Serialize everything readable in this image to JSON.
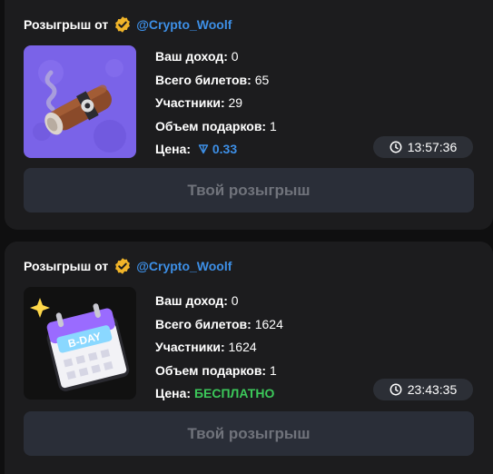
{
  "giveaways": [
    {
      "from_label": "Розыгрыш от",
      "username": "@Crypto_Woolf",
      "income_label": "Ваш доход:",
      "income_value": "0",
      "tickets_label": "Всего билетов:",
      "tickets_value": "65",
      "participants_label": "Участники:",
      "participants_value": "29",
      "gifts_label": "Объем подарков:",
      "gifts_value": "1",
      "price_label": "Цена:",
      "price_value": "0.33",
      "price_icon": "ton-icon",
      "timer": "13:57:36",
      "button_label": "Твой розыгрыш",
      "image": "cigar-gift"
    },
    {
      "from_label": "Розыгрыш от",
      "username": "@Crypto_Woolf",
      "income_label": "Ваш доход:",
      "income_value": "0",
      "tickets_label": "Всего билетов:",
      "tickets_value": "1624",
      "participants_label": "Участники:",
      "participants_value": "1624",
      "gifts_label": "Объем подарков:",
      "gifts_value": "1",
      "price_label": "Цена:",
      "price_value": "БЕСПЛАТНО",
      "timer": "23:43:35",
      "button_label": "Твой розыгрыш",
      "image": "bday-calendar-gift"
    }
  ],
  "colors": {
    "accent": "#3d8fe6",
    "free": "#3cc85a",
    "verified": "#f0b429",
    "card": "#1c1c1e",
    "button": "#2a2e38"
  }
}
